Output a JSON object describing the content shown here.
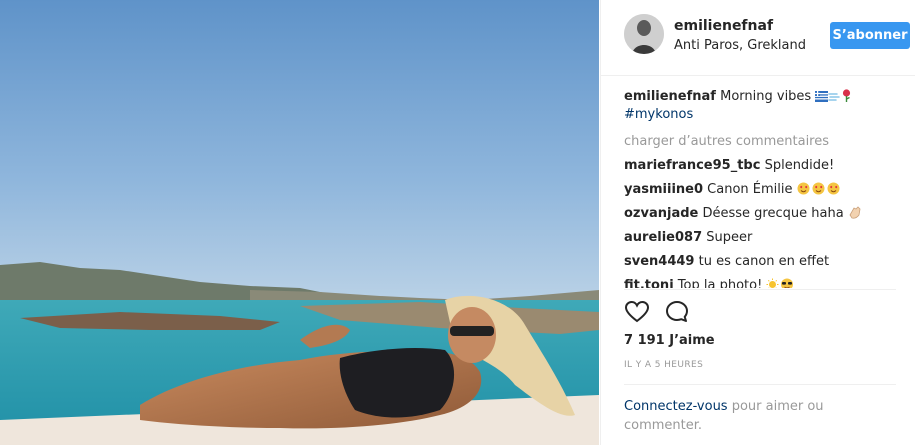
{
  "post": {
    "username": "emilienefnaf",
    "location": "Anti Paros, Grekland",
    "follow_label": "S’abonner",
    "caption": {
      "username": "emilienefnaf",
      "text": "Morning vibes",
      "hashtag": "#mykonos"
    },
    "load_more_label": "charger d’autres commentaires",
    "comments": [
      {
        "user": "mariefrance95_tbc",
        "text": "Splendide!"
      },
      {
        "user": "yasmiiine0",
        "text": "Canon Émilie"
      },
      {
        "user": "ozvanjade",
        "text": "Déesse grecque haha"
      },
      {
        "user": "aurelie087",
        "text": "Supeer"
      },
      {
        "user": "sven4449",
        "text": "tu es canon en effet"
      },
      {
        "user": "fit.toni",
        "text": "Top la photo!"
      }
    ],
    "likes_text": "7 191 J’aime",
    "time_text": "IL Y A 5 HEURES",
    "login_link": "Connectez-vous",
    "login_rest": " pour aimer ou commenter."
  },
  "icons": {
    "like": "heart-icon",
    "comment": "speech-bubble-icon",
    "caption_emojis": [
      "greek-flag-emoji",
      "dash-emoji",
      "rose-emoji"
    ],
    "comment_emojis": [
      "heart-eyes-emoji",
      "clapping-hands-emoji",
      "sun-emoji",
      "sunglasses-emoji"
    ]
  },
  "colors": {
    "follow_button": "#3897f0",
    "hashtag": "#003569",
    "muted": "#999999"
  }
}
